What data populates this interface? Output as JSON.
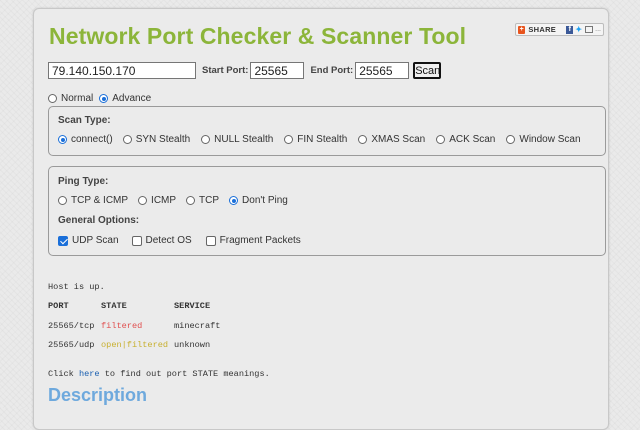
{
  "title": "Network Port Checker & Scanner Tool",
  "share": {
    "label": "SHARE",
    "more": "..."
  },
  "form": {
    "ip_value": "79.140.150.170",
    "start_port_label": "Start Port:",
    "start_port_value": "25565",
    "end_port_label": "End Port:",
    "end_port_value": "25565",
    "scan_label": "Scan"
  },
  "mode": [
    {
      "label": "Normal",
      "checked": false
    },
    {
      "label": "Advance",
      "checked": true
    }
  ],
  "scan_type": {
    "heading": "Scan Type:",
    "options": [
      {
        "label": "connect()",
        "checked": true
      },
      {
        "label": "SYN Stealth",
        "checked": false
      },
      {
        "label": "NULL Stealth",
        "checked": false
      },
      {
        "label": "FIN Stealth",
        "checked": false
      },
      {
        "label": "XMAS Scan",
        "checked": false
      },
      {
        "label": "ACK Scan",
        "checked": false
      },
      {
        "label": "Window Scan",
        "checked": false
      }
    ]
  },
  "ping_type": {
    "heading": "Ping Type:",
    "options": [
      {
        "label": "TCP & ICMP",
        "checked": false
      },
      {
        "label": "ICMP",
        "checked": false
      },
      {
        "label": "TCP",
        "checked": false
      },
      {
        "label": "Don't Ping",
        "checked": true
      }
    ]
  },
  "general": {
    "heading": "General Options:",
    "options": [
      {
        "label": "UDP Scan",
        "checked": true
      },
      {
        "label": "Detect OS",
        "checked": false
      },
      {
        "label": "Fragment Packets",
        "checked": false
      }
    ]
  },
  "result": {
    "host_status": "Host is up.",
    "col_port": "PORT",
    "col_state": "STATE",
    "col_service": "SERVICE",
    "rows": [
      {
        "port": "25565/tcp",
        "state": "filtered",
        "service": "minecraft"
      },
      {
        "port": "25565/udp",
        "state": "open|filtered",
        "service": "unknown"
      }
    ],
    "footer_pre": "Click ",
    "footer_link": "here",
    "footer_post": " to find out port STATE meanings."
  },
  "description_heading": "Description",
  "colors": {
    "title": "#8cb53a",
    "filtered": "#e05050",
    "open_filtered": "#c8b030",
    "link": "#1a5fb0",
    "description": "#6ea9dd"
  }
}
